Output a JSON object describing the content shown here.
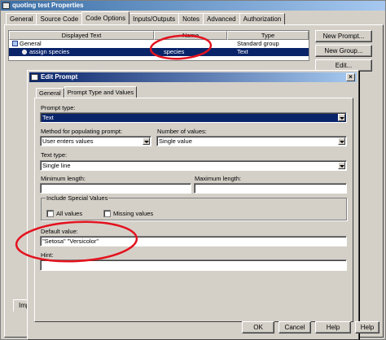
{
  "window": {
    "title": "quoting test Properties"
  },
  "tabs": [
    "General",
    "Source Code",
    "Code Options",
    "Inputs/Outputs",
    "Notes",
    "Advanced",
    "Authorization"
  ],
  "active_tab": "Code Options",
  "prompts_grid": {
    "columns": [
      "Displayed Text",
      "Name",
      "Type"
    ],
    "rows": [
      {
        "text": "General",
        "name": "",
        "type": "Standard group"
      },
      {
        "text": "assign species",
        "name": "species",
        "type": "Text"
      }
    ]
  },
  "side_buttons": [
    "New Prompt...",
    "New Group...",
    "Edit..."
  ],
  "import_button": "Imp",
  "dialog": {
    "title": "Edit Prompt",
    "close": "×",
    "tabs": [
      "General",
      "Prompt Type and Values"
    ],
    "active_tab": "Prompt Type and Values",
    "prompt_type": {
      "label": "Prompt type:",
      "value": "Text"
    },
    "method": {
      "label": "Method for populating prompt:",
      "value": "User enters values"
    },
    "num_values": {
      "label": "Number of values:",
      "value": "Single value"
    },
    "text_type": {
      "label": "Text type:",
      "value": "Single line"
    },
    "min_length": {
      "label": "Minimum length:",
      "value": ""
    },
    "max_length": {
      "label": "Maximum length:",
      "value": ""
    },
    "special_values": {
      "title": "Include Special Values",
      "all_values": "All values",
      "missing_values": "Missing values"
    },
    "default_value": {
      "label": "Default value:",
      "value": "\"Setosa\" \"Versicolor\""
    },
    "hint": {
      "label": "Hint:",
      "value": ""
    },
    "buttons": {
      "ok": "OK",
      "cancel": "Cancel",
      "help": "Help",
      "help_right": "Help"
    }
  },
  "colors": {
    "annotation": "#e3121e",
    "selection": "#0a246a",
    "face": "#d4d0c8"
  }
}
